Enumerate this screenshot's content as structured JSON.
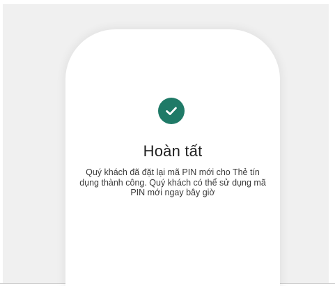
{
  "colors": {
    "accent": "#1f7a67",
    "background": "#f0f0f0",
    "card": "#ffffff"
  },
  "result": {
    "icon": "check-circle-icon",
    "title": "Hoàn tất",
    "message": "Quý khách đã đặt lại mã PIN mới cho Thẻ tín dụng thành công. Quý khách có thể sử dụng mã PIN mới ngay bây giờ"
  }
}
